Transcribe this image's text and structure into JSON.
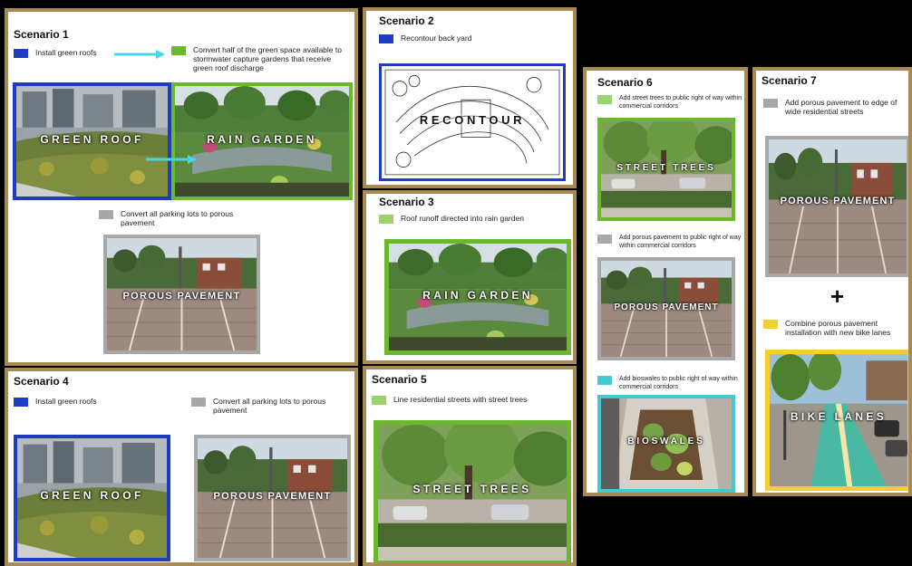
{
  "colors": {
    "frame": "#a88a55",
    "green_roof": "#1f3bbf",
    "rain_garden": "#69b82e",
    "porous_pavement": "#a8a8a8",
    "street_trees": "#9bd36b",
    "bioswales": "#46c8d4",
    "bike_lanes": "#f2cf2e"
  },
  "scenario1": {
    "title": "Scenario 1",
    "legend_roofs": "Install green roofs",
    "legend_convert": "Convert half of the green space available to stormwater capture gardens that receive green roof discharge",
    "legend_parking": "Convert all parking lots to porous pavement",
    "label_green_roof": "GREEN ROOF",
    "label_rain_garden": "RAIN GARDEN",
    "label_porous": "POROUS PAVEMENT"
  },
  "scenario2": {
    "title": "Scenario 2",
    "legend": "Recontour back yard",
    "label": "RECONTOUR"
  },
  "scenario3": {
    "title": "Scenario 3",
    "legend": "Roof runoff directed into rain garden",
    "label": "RAIN GARDEN"
  },
  "scenario4": {
    "title": "Scenario 4",
    "legend_roofs": "Install green roofs",
    "legend_parking": "Convert all parking lots to porous pavement",
    "label_green_roof": "GREEN ROOF",
    "label_porous": "POROUS PAVEMENT"
  },
  "scenario5": {
    "title": "Scenario 5",
    "legend": "Line residential streets with street trees",
    "label": "STREET TREES"
  },
  "scenario6": {
    "title": "Scenario 6",
    "legend_trees": "Add street trees to public right of way within commercial corridors",
    "legend_porous": "Add porous pavement to public right of way within commercial corridors",
    "legend_bioswales": "Add bioswales to public right of way within commercial corridors",
    "label_trees": "STREET TREES",
    "label_porous": "POROUS PAVEMENT",
    "label_bioswales": "BIOSWALES"
  },
  "scenario7": {
    "title": "Scenario 7",
    "legend_porous": "Add porous pavement to edge of wide residential streets",
    "plus": "+",
    "legend_bike": "Combine porous pavement installation with new bike lanes",
    "label_porous": "POROUS PAVEMENT",
    "label_bike": "BIKE LANES"
  }
}
